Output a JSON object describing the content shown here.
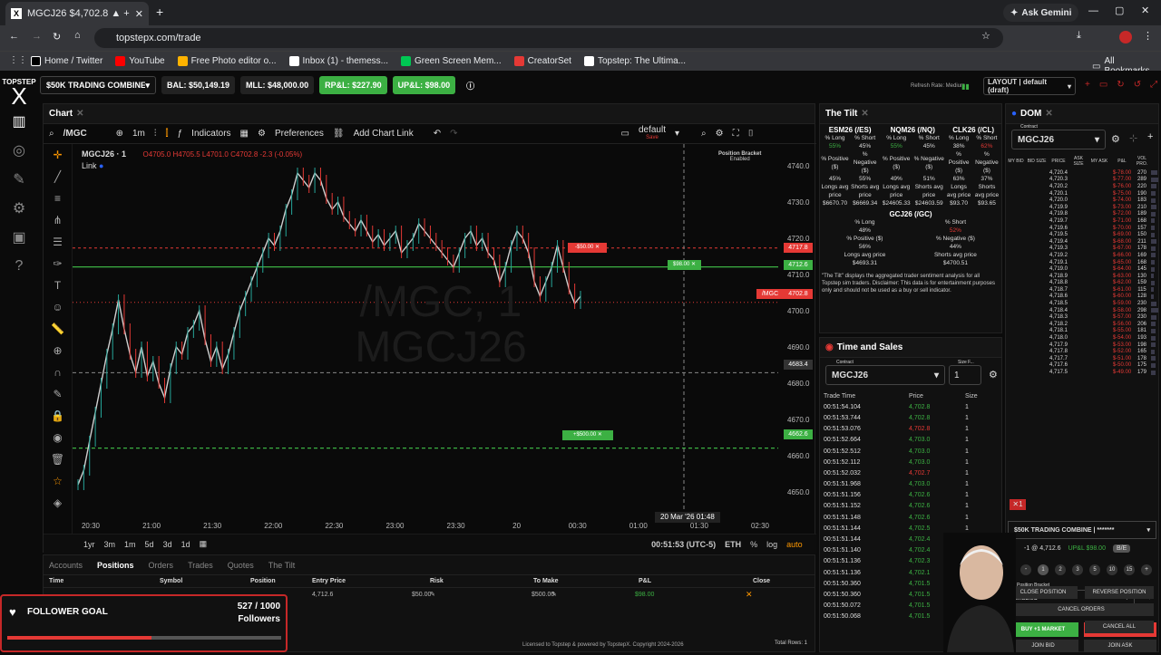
{
  "browser": {
    "tab_title": "MGCJ26 $4,702.8 ▲ +2.11%",
    "url": "topstepx.com/trade",
    "profile": "Ask Gemini",
    "bookmarks": [
      {
        "label": "Home / Twitter",
        "color": "#000"
      },
      {
        "label": "YouTube",
        "color": "#ff0000"
      },
      {
        "label": "Free Photo editor o...",
        "color": "#ffb300"
      },
      {
        "label": "Inbox (1) - themess...",
        "color": "#fff"
      },
      {
        "label": "Green Screen Mem...",
        "color": "#00c853"
      },
      {
        "label": "CreatorSet",
        "color": "#e53935"
      },
      {
        "label": "Topstep: The Ultima...",
        "color": "#fff"
      }
    ],
    "all_bookmarks": "All Bookmarks"
  },
  "app": {
    "logo_top": "TOPSTEP",
    "logo": "X",
    "account": "$50K TRADING COMBINE | *...",
    "bal": "BAL: $50,149.19",
    "mll": "MLL: $48,000.00",
    "rpl": "RP&L: $227.90",
    "upl": "UP&L: $98.00",
    "refresh": "Refresh Rate: Medium",
    "layout": "LAYOUT | default (draft)"
  },
  "chart": {
    "tab": "Chart",
    "symbol": "/MGC",
    "interval": "1m",
    "indicators": "Indicators",
    "preferences": "Preferences",
    "add_link": "Add Chart Link",
    "template": "default",
    "save": "Save",
    "legend": "MGCJ26 · 1",
    "ohlc": "O4705.0 H4705.5 L4701.0 C4702.8 -2.3 (-0.05%)",
    "link": "Link",
    "watermark1": "/MGC, 1",
    "watermark2": "MGCJ26",
    "bracket_label": "Position Bracket",
    "bracket_state": "Enabled",
    "price_labels": [
      "4740.0",
      "4730.0",
      "4720.0",
      "4710.0",
      "4700.0",
      "4690.0",
      "4680.0",
      "4670.0",
      "4660.0",
      "4650.0"
    ],
    "time_labels": [
      "20:30",
      "21:00",
      "21:30",
      "22:00",
      "22:30",
      "23:00",
      "23:30",
      "20",
      "00:30",
      "01:00",
      "01:30",
      "02:30"
    ],
    "crosshair_time": "20 Mar '26  01:48",
    "crosshair_price": "4683.4",
    "last_price": "4702.8",
    "last_label": "/MGC",
    "sl_price": "4717.8",
    "sl_text": "-$50.00",
    "entry_price": "4712.6",
    "entry_text": "$98.00",
    "tp_price": "4662.6",
    "tp_text": "+$500.00",
    "timeframes": [
      "1yr",
      "3m",
      "1m",
      "5d",
      "3d",
      "1d"
    ],
    "clock": "00:51:53 (UTC-5)",
    "session": "ETH",
    "log": "log",
    "auto": "auto",
    "chart_data": {
      "type": "line",
      "x_start": "20:20",
      "x_end": "02:40",
      "ylim": [
        4646,
        4744
      ],
      "values": [
        4652,
        4656,
        4664,
        4672,
        4680,
        4688,
        4695,
        4703,
        4695,
        4688,
        4683,
        4690,
        4682,
        4686,
        4680,
        4676,
        4684,
        4690,
        4688,
        4694,
        4696,
        4700,
        4692,
        4686,
        4690,
        4684,
        4688,
        4694,
        4700,
        4704,
        4708,
        4712,
        4716,
        4720,
        4718,
        4722,
        4728,
        4732,
        4738,
        4736,
        4734,
        4738,
        4736,
        4731,
        4728,
        4730,
        4726,
        4724,
        4722,
        4725,
        4722,
        4719,
        4721,
        4718,
        4720,
        4722,
        4716,
        4718,
        4720,
        4724,
        4722,
        4720,
        4718,
        4716,
        4714,
        4712,
        4716,
        4720,
        4722,
        4718,
        4720,
        4716,
        4714,
        4708,
        4712,
        4718,
        4722,
        4720,
        4716,
        4708,
        4704,
        4708,
        4712,
        4718,
        4712,
        4706,
        4702,
        4704
      ]
    }
  },
  "positions": {
    "tabs": [
      "Accounts",
      "Positions",
      "Orders",
      "Trades",
      "Quotes",
      "The Tilt"
    ],
    "headers": [
      "Time",
      "Symbol",
      "Position",
      "Entry Price",
      "Risk",
      "To Make",
      "P&L",
      "Close"
    ],
    "row": {
      "entry": "4,712.6",
      "risk": "$50.00",
      "tomake": "$500.00",
      "pnl": "$98.00"
    },
    "total": "Total Rows: 1"
  },
  "tilt": {
    "title": "The Tilt",
    "symbols": [
      "ESM26 (/ES)",
      "NQM26 (/NQ)",
      "CLK26 (/CL)"
    ],
    "gc": "GCJ26 (/GC)",
    "r1": [
      "% Long",
      "% Short",
      "% Long",
      "% Short",
      "% Long",
      "% Short"
    ],
    "r2": [
      "55%",
      "45%",
      "55%",
      "45%",
      "38%",
      "62%"
    ],
    "r3": [
      "% Positive ($)",
      "% Negative ($)",
      "% Positive ($)",
      "% Negative ($)",
      "% Positive ($)",
      "% Negative ($)"
    ],
    "r4": [
      "45%",
      "55%",
      "49%",
      "51%",
      "63%",
      "37%"
    ],
    "r5": [
      "Longs avg price",
      "Shorts avg price",
      "Longs avg price",
      "Shorts avg price",
      "Longs avg price",
      "Shorts avg price"
    ],
    "r6": [
      "$6670.70",
      "$6669.34",
      "$24605.33",
      "$24603.59",
      "$93.70",
      "$93.65"
    ],
    "gc_rows": [
      [
        "% Long",
        "% Short"
      ],
      [
        "48%",
        "52%"
      ],
      [
        "% Positive ($)",
        "% Negative ($)"
      ],
      [
        "56%",
        "44%"
      ],
      [
        "Longs avg price",
        "Shorts avg price"
      ],
      [
        "$4693.31",
        "$4700.51"
      ]
    ],
    "disclaimer": "\"The Tilt\" displays the aggregated trader sentiment analysis for all Topstep sim traders. Disclaimer: This data is for entertainment purposes only and should not be used as a buy or sell indicator."
  },
  "tns": {
    "title": "Time and Sales",
    "contract_label": "Contract",
    "contract": "MGCJ26",
    "size_label": "Size F...",
    "size": "1",
    "headers": [
      "Trade Time",
      "Price",
      "Size"
    ],
    "rows": [
      [
        "00:51:54.104",
        "4,702.8",
        "1"
      ],
      [
        "00:51:53.744",
        "4,702.8",
        "1"
      ],
      [
        "00:51:53.076",
        "4,702.8",
        "1"
      ],
      [
        "00:51:52.664",
        "4,703.0",
        "1"
      ],
      [
        "00:51:52.512",
        "4,703.0",
        "1"
      ],
      [
        "00:51:52.112",
        "4,703.0",
        "1"
      ],
      [
        "00:51:52.032",
        "4,702.7",
        "1"
      ],
      [
        "00:51:51.968",
        "4,703.0",
        "1"
      ],
      [
        "00:51:51.156",
        "4,702.6",
        "1"
      ],
      [
        "00:51:51.152",
        "4,702.6",
        "1"
      ],
      [
        "00:51:51.148",
        "4,702.6",
        "1"
      ],
      [
        "00:51:51.144",
        "4,702.5",
        "1"
      ],
      [
        "00:51:51.144",
        "4,702.4",
        "1"
      ],
      [
        "00:51:51.140",
        "4,702.4",
        "1"
      ],
      [
        "00:51:51.136",
        "4,702.3",
        "1"
      ],
      [
        "00:51:51.136",
        "4,702.1",
        "1"
      ],
      [
        "00:51:50.360",
        "4,701.5",
        "1"
      ],
      [
        "00:51:50.360",
        "4,701.5",
        "1"
      ],
      [
        "00:51:50.072",
        "4,701.5",
        "1"
      ],
      [
        "00:51:50.068",
        "4,701.5",
        "1"
      ]
    ]
  },
  "dom": {
    "title": "DOM",
    "contract_label": "Contract",
    "contract": "MGCJ26",
    "headers": [
      "MY BID",
      "BID SIZE",
      "PRICE",
      "ASK SIZE",
      "MY ASK",
      "P&L",
      "VOL PRO."
    ],
    "prices": [
      "4,720.4",
      "4,720.3",
      "4,720.2",
      "4,720.1",
      "4,720.0",
      "4,719.9",
      "4,719.8",
      "4,719.7",
      "4,719.6",
      "4,719.5",
      "4,719.4",
      "4,719.3",
      "4,719.2",
      "4,719.1",
      "4,719.0",
      "4,718.9",
      "4,718.8",
      "4,718.7",
      "4,718.6",
      "4,718.5",
      "4,718.4",
      "4,718.3",
      "4,718.2",
      "4,718.1",
      "4,718.0",
      "4,717.9",
      "4,717.8",
      "4,717.7",
      "4,717.6",
      "4,717.5"
    ],
    "pnls": [
      "$-78.00",
      "$-77.00",
      "$-76.00",
      "$-75.00",
      "$-74.00",
      "$-73.00",
      "$-72.00",
      "$-71.00",
      "$-70.00",
      "$-69.00",
      "$-68.00",
      "$-67.00",
      "$-66.00",
      "$-65.00",
      "$-64.00",
      "$-63.00",
      "$-62.00",
      "$-61.00",
      "$-60.00",
      "$-59.00",
      "$-58.00",
      "$-57.00",
      "$-56.00",
      "$-55.00",
      "$-54.00",
      "$-53.00",
      "$-52.00",
      "$-51.00",
      "$-50.00",
      "$-49.00"
    ],
    "vols": [
      "270",
      "289",
      "220",
      "190",
      "183",
      "210",
      "189",
      "168",
      "157",
      "150",
      "211",
      "178",
      "169",
      "168",
      "145",
      "130",
      "159",
      "115",
      "128",
      "230",
      "298",
      "230",
      "206",
      "181",
      "193",
      "198",
      "165",
      "178",
      "175",
      "179"
    ],
    "account": "$50K TRADING COMBINE | *******",
    "pos": "-1 @ 4,712.6",
    "upl": "UP&L $98.00",
    "be": "B/E",
    "qty": [
      "1",
      "2",
      "3",
      "5",
      "10",
      "15"
    ],
    "bracket_label": "Position Bracket",
    "bracket": "Enabled",
    "buy": "BUY +1 MARKET",
    "sell": "SELL -1 MARKET",
    "join_bid": "JOIN BID",
    "join_ask": "JOIN ASK",
    "close": "CLOSE POSITION",
    "reverse": "REVERSE POSITION",
    "cancel": "CANCEL ORDERS",
    "cancel_all": "CANCEL ALL"
  },
  "follower": {
    "title": "FOLLOWER GOAL",
    "count": "527 / 1000",
    "label": "Followers",
    "progress": 0.527
  },
  "footer": "Licensed to Topstep & powered by TopstepX. Copyright 2024-2026"
}
